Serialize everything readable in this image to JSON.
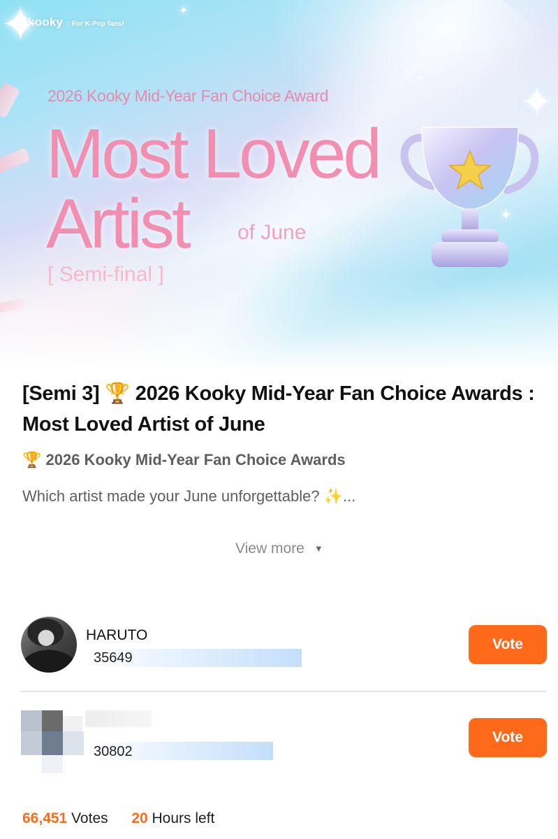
{
  "banner": {
    "brand": "kooky",
    "tagline": ": For K-Pop fans!",
    "event_subtitle": "2026 Kooky Mid-Year Fan Choice Award",
    "headline_line1": "Most Loved",
    "headline_line2": "Artist",
    "headline_suffix": "of June",
    "stage_label": "[ Semi-final ]",
    "trophy_icon": "trophy-icon"
  },
  "post": {
    "title": "[Semi 3] 🏆 2026 Kooky Mid-Year Fan Choice Awards : Most Loved Artist of June",
    "event_line": "🏆 2026 Kooky Mid-Year Fan Choice Awards",
    "description": "Which artist made your June unforgettable? ✨...",
    "view_more": "View more",
    "view_more_icon": "caret-down-icon"
  },
  "candidates": [
    {
      "name": "HARUTO",
      "votes": "35649",
      "vote_share": 0.537,
      "vote_label": "Vote"
    },
    {
      "name": "",
      "votes": "30802",
      "vote_share": 0.463,
      "vote_label": "Vote"
    }
  ],
  "stats": {
    "total_votes": "66,451",
    "votes_label": "Votes",
    "time_left": "20",
    "time_label": "Hours left"
  },
  "colors": {
    "accent": "#ff6a1a",
    "title_pink": "#f28fb0",
    "bar_blue": "#c4defa",
    "divider": "#e3e3e3"
  }
}
